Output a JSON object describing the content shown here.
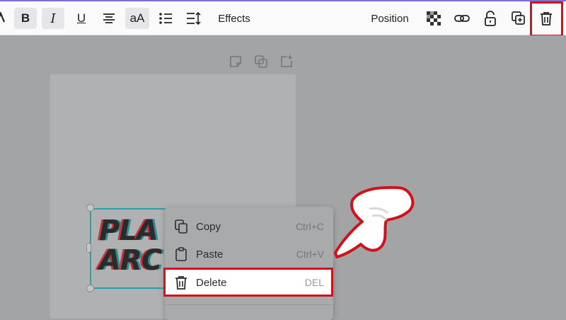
{
  "toolbar": {
    "bold_label": "B",
    "italic_label": "I",
    "underline_label": "U",
    "case_label": "aA",
    "effects_label": "Effects",
    "position_label": "Position"
  },
  "icons": [
    "text-color-icon",
    "bold-icon",
    "italic-icon",
    "underline-icon",
    "align-center-icon",
    "case-icon",
    "bullet-list-icon",
    "line-spacing-icon",
    "transparency-icon",
    "link-icon",
    "lock-icon",
    "duplicate-icon",
    "trash-icon",
    "page-note-icon",
    "page-copy-icon",
    "page-add-icon",
    "copy-icon",
    "paste-icon",
    "delete-icon",
    "pointing-hand-icon"
  ],
  "canvas": {
    "text_lines": [
      "PLA",
      "ARC"
    ]
  },
  "context_menu": {
    "items": [
      {
        "label": "Copy",
        "shortcut": "Ctrl+C"
      },
      {
        "label": "Paste",
        "shortcut": "Ctrl+V"
      },
      {
        "label": "Delete",
        "shortcut": "DEL"
      }
    ]
  },
  "colors": {
    "highlight": "#d0121b",
    "selection": "#2a9fa8",
    "toolbar_bg": "#fafafa",
    "overlay_bg": "#a3a4a6"
  }
}
